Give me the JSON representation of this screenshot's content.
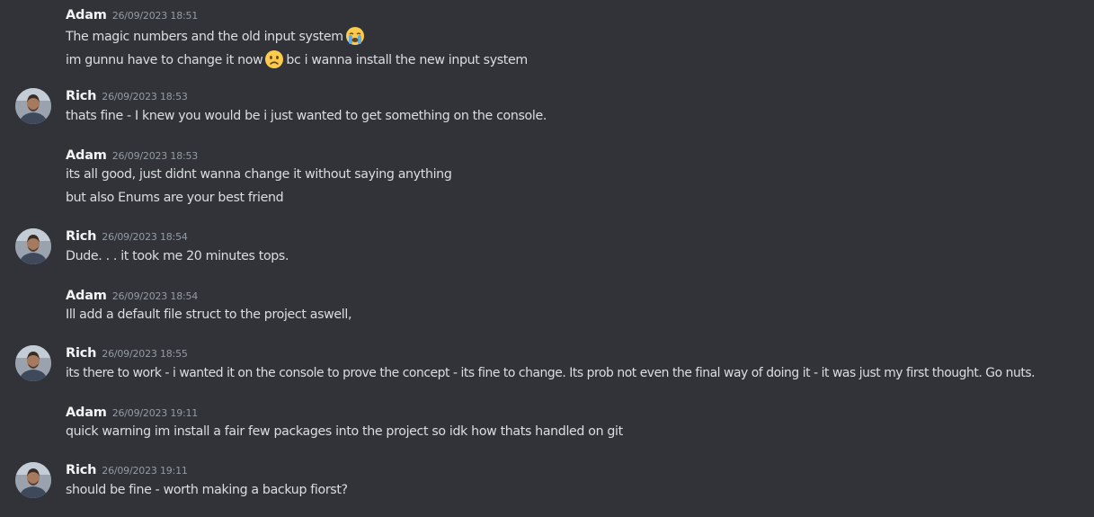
{
  "messages": [
    {
      "author": "Adam",
      "timestamp": "26/09/2023 18:51",
      "lines": [
        {
          "text": "The magic numbers and the old input system",
          "emoji": "sob-emoji"
        },
        {
          "text": "im gunnu have to change it now",
          "emoji": "frowning-emoji",
          "text_after": "bc i wanna install the new input system"
        }
      ]
    },
    {
      "author": "Rich",
      "timestamp": "26/09/2023 18:53",
      "lines": [
        {
          "text": "thats fine - I knew you would be i just wanted to get something on the console."
        }
      ]
    },
    {
      "author": "Adam",
      "timestamp": "26/09/2023 18:53",
      "lines": [
        {
          "text": "its all good, just didnt wanna change it without saying anything"
        },
        {
          "text": "but also Enums are your best friend"
        }
      ]
    },
    {
      "author": "Rich",
      "timestamp": "26/09/2023 18:54",
      "lines": [
        {
          "text": "Dude. . . it took me 20 minutes tops."
        }
      ]
    },
    {
      "author": "Adam",
      "timestamp": "26/09/2023 18:54",
      "lines": [
        {
          "text": "Ill add a default file struct to the project aswell,"
        }
      ]
    },
    {
      "author": "Rich",
      "timestamp": "26/09/2023 18:55",
      "lines": [
        {
          "text": "its there to work - i wanted it on the console to prove the concept - its fine to change. Its prob not even the final way of doing it - it was just my first thought. Go nuts."
        }
      ]
    },
    {
      "author": "Adam",
      "timestamp": "26/09/2023 19:11",
      "lines": [
        {
          "text": "quick warning im install a fair few packages into the project so idk how thats handled on git"
        }
      ]
    },
    {
      "author": "Rich",
      "timestamp": "26/09/2023 19:11",
      "lines": [
        {
          "text": "should be fine - worth making a backup fiorst?"
        }
      ]
    }
  ],
  "colors": {
    "background": "#313338",
    "text": "#dbdee1",
    "author": "#f2f3f5",
    "timestamp": "#949ba4"
  }
}
